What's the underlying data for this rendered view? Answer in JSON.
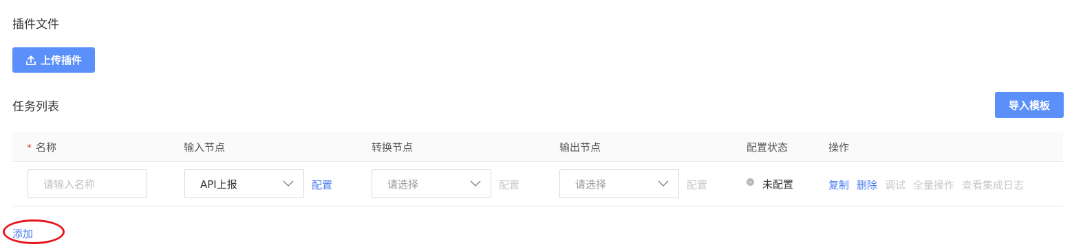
{
  "plugin_section": {
    "title": "插件文件",
    "upload_button": "上传插件",
    "upload_icon": "upload-icon"
  },
  "task_section": {
    "title": "任务列表",
    "import_button": "导入模板"
  },
  "table": {
    "headers": {
      "required_mark": "*",
      "name": "名称",
      "input_node": "输入节点",
      "transform_node": "转换节点",
      "output_node": "输出节点",
      "config_status": "配置状态",
      "actions": "操作"
    },
    "rows": [
      {
        "name_placeholder": "请输入名称",
        "input_node_value": "API上报",
        "input_node_config": "配置",
        "transform_node_placeholder": "请选择",
        "transform_node_config": "配置",
        "output_node_placeholder": "请选择",
        "output_node_config": "配置",
        "status": "未配置",
        "actions": {
          "copy": "复制",
          "delete": "删除",
          "debug": "调试",
          "full_ops": "全量操作",
          "view_logs": "查看集成日志"
        }
      }
    ]
  },
  "add_link": "添加",
  "colors": {
    "primary": "#5b8ff9",
    "link": "#4a7df0",
    "disabled": "#c8c8c8",
    "annotation": "#e8141b"
  }
}
